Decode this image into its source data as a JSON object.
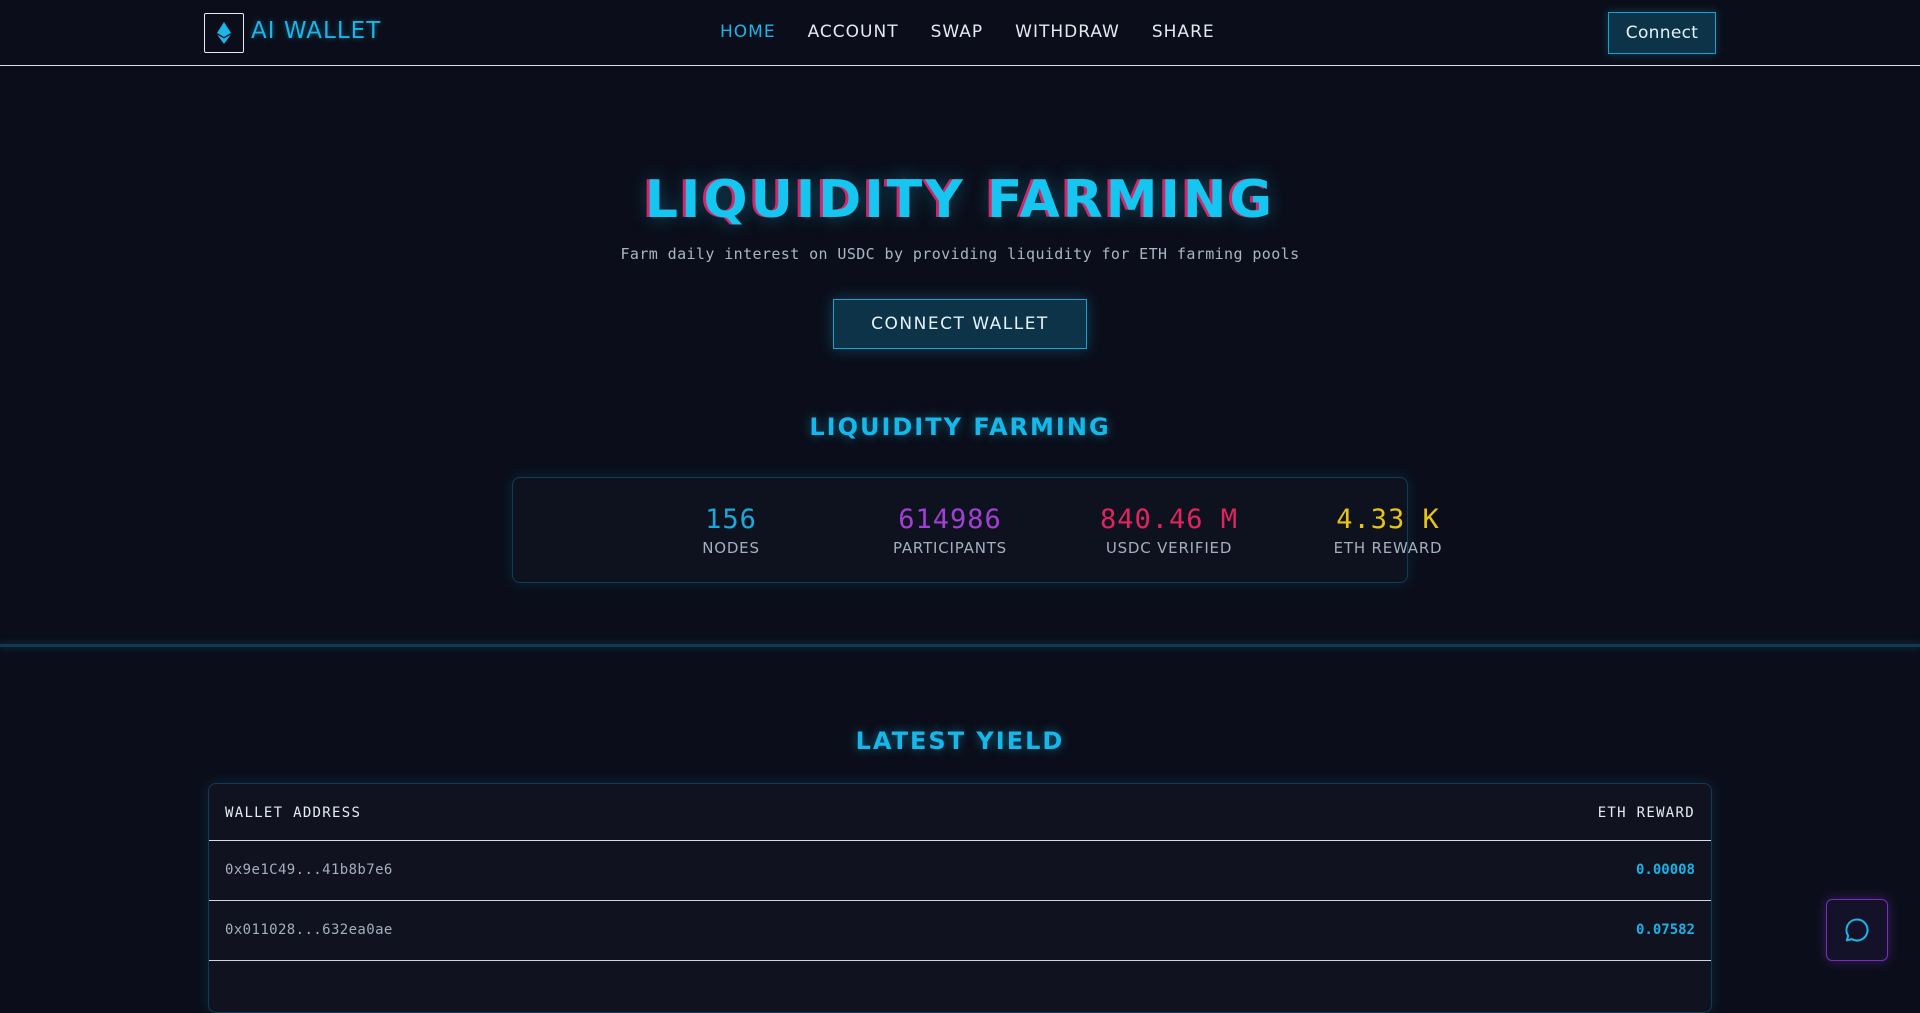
{
  "nav": {
    "logo_text": "AI WALLET",
    "links": [
      "HOME",
      "ACCOUNT",
      "SWAP",
      "WITHDRAW",
      "SHARE"
    ],
    "active_link": "HOME",
    "connect_label": "Connect"
  },
  "hero": {
    "title": "LIQUIDITY FARMING",
    "subtitle": "Farm daily interest on USDC by providing liquidity for ETH farming pools",
    "cta_label": "CONNECT WALLET"
  },
  "stats_section": {
    "title": "LIQUIDITY FARMING",
    "items": [
      {
        "value": "156",
        "label": "NODES",
        "color": "#1aa9dc"
      },
      {
        "value": "614986",
        "label": "PARTICIPANTS",
        "color": "#a33fd6"
      },
      {
        "value": "840.46 M",
        "label": "USDC VERIFIED",
        "color": "#e0245e"
      },
      {
        "value": "4.33 K",
        "label": "ETH REWARD",
        "color": "#e8c511"
      }
    ]
  },
  "yield_section": {
    "title": "LATEST YIELD",
    "columns": [
      "WALLET ADDRESS",
      "ETH REWARD"
    ],
    "rows": [
      {
        "address": "0x9e1C49...41b8b7e6",
        "reward": "0.00008"
      },
      {
        "address": "0x011028...632ea0ae",
        "reward": "0.07582"
      }
    ]
  },
  "icons": {
    "logo": "ethereum-icon",
    "chat": "chat-bubble-icon"
  },
  "colors": {
    "accent": "#14b8ea",
    "background": "#0b0e1a",
    "glitch": "#d6246a"
  }
}
